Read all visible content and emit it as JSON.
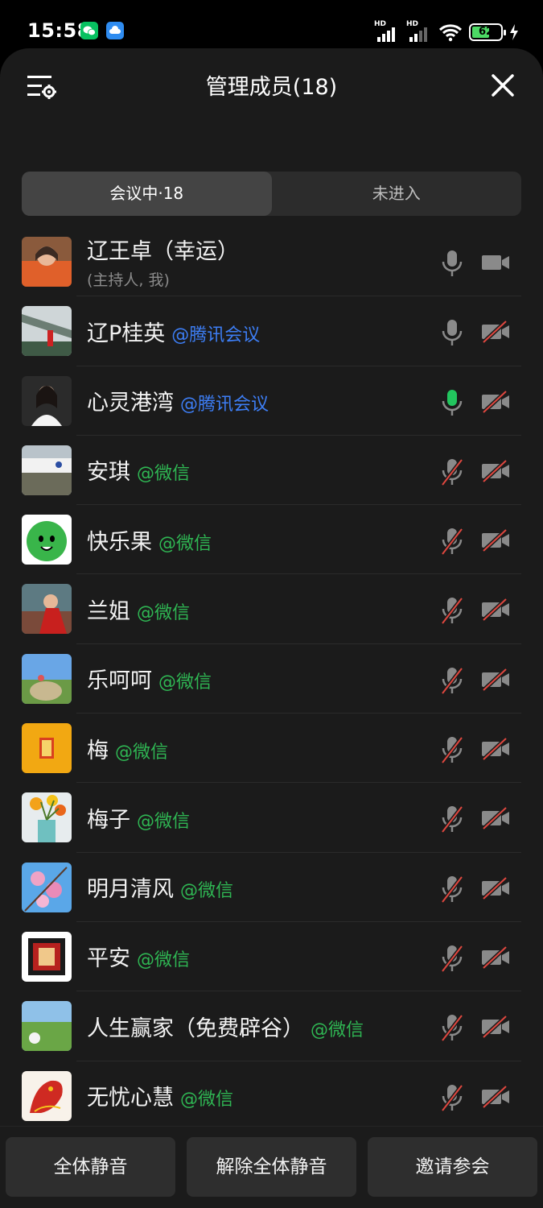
{
  "status_bar": {
    "time": "15:58",
    "battery": "62",
    "signal_1": "HD",
    "signal_2": "HD"
  },
  "header": {
    "title": "管理成员(18)",
    "settings_icon": "list-settings-icon",
    "close_icon": "close-icon"
  },
  "tabs": {
    "in_meeting": "会议中·18",
    "not_joined": "未进入"
  },
  "members": [
    {
      "name": "辽王卓（幸运）",
      "tag": "",
      "sub": "(主持人, 我)",
      "mic": "on-gray",
      "cam": "on-gray"
    },
    {
      "name": "辽P桂英",
      "tag": "@腾讯会议",
      "tag_color": "blue",
      "mic": "on-gray",
      "cam": "off"
    },
    {
      "name": "心灵港湾",
      "tag": "@腾讯会议",
      "tag_color": "blue",
      "mic": "speaking",
      "cam": "off"
    },
    {
      "name": "安琪",
      "tag": "@微信",
      "tag_color": "green",
      "mic": "off",
      "cam": "off"
    },
    {
      "name": "快乐果",
      "tag": "@微信",
      "tag_color": "green",
      "mic": "off",
      "cam": "off"
    },
    {
      "name": "兰姐",
      "tag": "@微信",
      "tag_color": "green",
      "mic": "off",
      "cam": "off"
    },
    {
      "name": "乐呵呵",
      "tag": "@微信",
      "tag_color": "green",
      "mic": "off",
      "cam": "off"
    },
    {
      "name": "梅",
      "tag": "@微信",
      "tag_color": "green",
      "mic": "off",
      "cam": "off"
    },
    {
      "name": "梅子",
      "tag": "@微信",
      "tag_color": "green",
      "mic": "off",
      "cam": "off"
    },
    {
      "name": "明月清风",
      "tag": "@微信",
      "tag_color": "green",
      "mic": "off",
      "cam": "off"
    },
    {
      "name": "平安",
      "tag": "@微信",
      "tag_color": "green",
      "mic": "off",
      "cam": "off"
    },
    {
      "name": "人生赢家（免费辟谷）",
      "tag": "@微信",
      "tag_color": "green",
      "mic": "off",
      "cam": "off"
    },
    {
      "name": "无忧心慧",
      "tag": "@微信",
      "tag_color": "green",
      "mic": "off",
      "cam": "off"
    }
  ],
  "actions": {
    "mute_all": "全体静音",
    "unmute_all": "解除全体静音",
    "invite": "邀请参会"
  },
  "colors": {
    "background": "#1b1b1b",
    "wechat_green": "#2fb653",
    "tencent_blue": "#3d7ef5",
    "muted_red": "#e0473f",
    "speaking_green": "#22c55e"
  }
}
